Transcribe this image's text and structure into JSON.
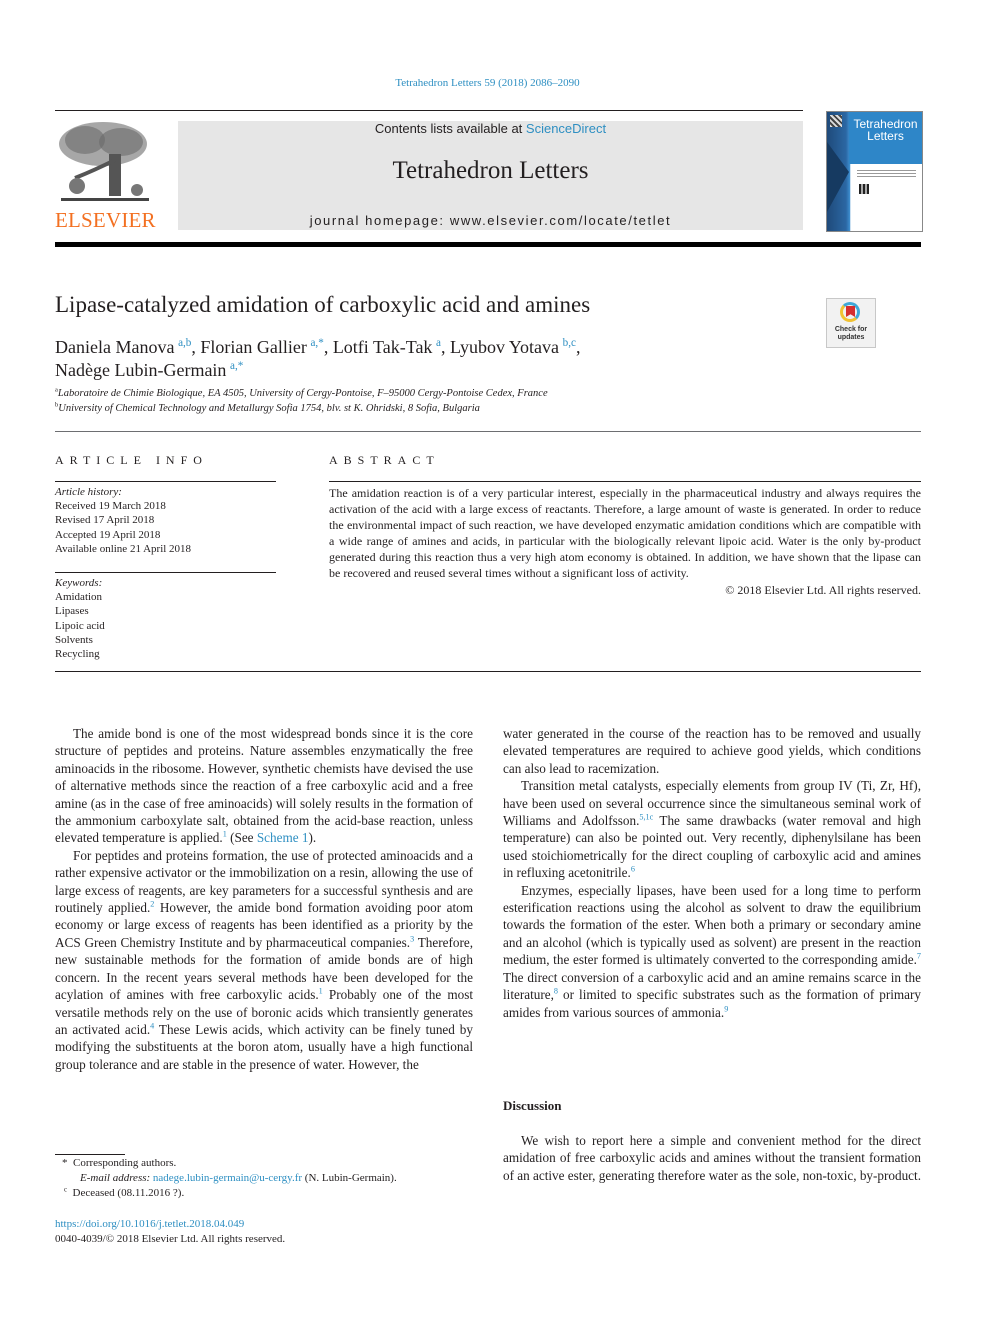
{
  "header": {
    "citation": "Tetrahedron Letters 59 (2018) 2086–2090",
    "contents_prefix": "Contents lists available at ",
    "contents_link": "ScienceDirect",
    "journal_title": "Tetrahedron Letters",
    "homepage": "journal homepage: www.elsevier.com/locate/tetlet",
    "publisher_logo_text": "ELSEVIER",
    "cover_title_line1": "Tetrahedron",
    "cover_title_line2": "Letters",
    "crossmark_line1": "Check for",
    "crossmark_line2": "updates",
    "colors": {
      "link": "#2e8fc2",
      "publisher": "#f37021",
      "banner": "#e6e6e6"
    }
  },
  "article": {
    "title": "Lipase-catalyzed amidation of carboxylic acid and amines",
    "authors": [
      {
        "name": "Daniela Manova",
        "aff": "a,b",
        "sep": ", "
      },
      {
        "name": "Florian Gallier",
        "aff": "a,*",
        "sep": ", "
      },
      {
        "name": "Lotfi Tak-Tak",
        "aff": "a",
        "sep": ", "
      },
      {
        "name": "Lyubov Yotava",
        "aff": "b,c",
        "sep": ","
      },
      {
        "name": "Nadège Lubin-Germain",
        "aff": "a,*",
        "sep": ""
      }
    ],
    "affiliations": [
      {
        "key": "a",
        "text": "Laboratoire de Chimie Biologique, EA 4505, University of Cergy-Pontoise, F–95000 Cergy-Pontoise Cedex, France"
      },
      {
        "key": "b",
        "text": "University of Chemical Technology and Metallurgy Sofia 1754, blv. st K. Ohridski, 8 Sofia, Bulgaria"
      }
    ]
  },
  "article_info": {
    "heading": "ARTICLE INFO",
    "history_label": "Article history:",
    "history": [
      "Received 19 March 2018",
      "Revised 17 April 2018",
      "Accepted 19 April 2018",
      "Available online 21 April 2018"
    ],
    "keywords_label": "Keywords:",
    "keywords": [
      "Amidation",
      "Lipases",
      "Lipoic acid",
      "Solvents",
      "Recycling"
    ]
  },
  "abstract": {
    "heading": "ABSTRACT",
    "text": "The amidation reaction is of a very particular interest, especially in the pharmaceutical industry and always requires the activation of the acid with a large excess of reactants. Therefore, a large amount of waste is generated. In order to reduce the environmental impact of such reaction, we have developed enzymatic amidation conditions which are compatible with a wide range of amines and acids, in particular with the biologically relevant lipoic acid. Water is the only by-product generated during this reaction thus a very high atom economy is obtained. In addition, we have shown that the lipase can be recovered and reused several times without a significant loss of activity.",
    "copyright": "© 2018 Elsevier Ltd. All rights reserved."
  },
  "body": {
    "left": {
      "p1_a": "The amide bond is one of the most widespread bonds since it is the core structure of peptides and proteins. Nature assembles enzymatically the free aminoacids in the ribosome. However, synthetic chemists have devised the use of alternative methods since the reaction of a free carboxylic acid and a free amine (as in the case of free aminoacids) will solely results in the formation of the ammonium carboxylate salt, obtained from the acid-base reaction, unless elevated temperature is applied.",
      "p1_ref": "1",
      "p1_b": " (See ",
      "p1_link": "Scheme 1",
      "p1_c": ").",
      "p2_a": "For peptides and proteins formation, the use of protected aminoacids and a rather expensive activator or the immobilization on a resin, allowing the use of large excess of reagents, are key parameters for a successful synthesis and are routinely applied.",
      "p2_ref1": "2",
      "p2_b": " However, the amide bond formation avoiding poor atom economy or large excess of reagents has been identified as a priority by the ACS Green Chemistry Institute and by pharmaceutical companies.",
      "p2_ref2": "3",
      "p2_c": " Therefore, new sustainable methods for the formation of amide bonds are of high concern. In the recent years several methods have been developed for the acylation of amines with free carboxylic acids.",
      "p2_ref3": "1",
      "p2_d": " Probably one of the most versatile methods rely on the use of boronic acids which transiently generates an activated acid.",
      "p2_ref4": "4",
      "p2_e": " These Lewis acids, which activity can be finely tuned by modifying the substituents at the boron atom, usually have a high functional group tolerance and are stable in the presence of water. However, the"
    },
    "right": {
      "p0": "water generated in the course of the reaction has to be removed and usually elevated temperatures are required to achieve good yields, which conditions can also lead to racemization.",
      "p1_a": "Transition metal catalysts, especially elements from group IV (Ti, Zr, Hf), have been used on several occurrence since the simultaneous seminal work of Williams and Adolfsson.",
      "p1_ref1": "5,1c",
      "p1_b": " The same drawbacks (water removal and high temperature) can also be pointed out. Very recently, diphenylsilane has been used stoichiometrically for the direct coupling of carboxylic acid and amines in refluxing acetonitrile.",
      "p1_ref2": "6",
      "p2_a": "Enzymes, especially lipases, have been used for a long time to perform esterification reactions using the alcohol as solvent to draw the equilibrium towards the formation of the ester. When both a primary or secondary amine and an alcohol (which is typically used as solvent) are present in the reaction medium, the ester formed is ultimately converted to the corresponding amide.",
      "p2_ref1": "7",
      "p2_b": " The direct conversion of a carboxylic acid and an amine remains scarce in the literature,",
      "p2_ref2": "8",
      "p2_c": " or limited to specific substrates such as the formation of primary amides from various sources of ammonia.",
      "p2_ref3": "9",
      "discussion_heading": "Discussion",
      "p3": "We wish to report here a simple and convenient method for the direct amidation of free carboxylic acids and amines without the transient formation of an active ester, generating therefore water as the sole, non-toxic, by-product."
    }
  },
  "footnotes": {
    "corresponding_mark": "*",
    "corresponding": "Corresponding authors.",
    "email_label": "E-mail address: ",
    "email": "nadege.lubin-germain@u-cergy.fr",
    "email_owner": " (N. Lubin-Germain).",
    "deceased_mark": "c",
    "deceased": "Deceased (08.11.2016 ?).",
    "doi": "https://doi.org/10.1016/j.tetlet.2018.04.049",
    "issn": "0040-4039/© 2018 Elsevier Ltd. All rights reserved."
  }
}
